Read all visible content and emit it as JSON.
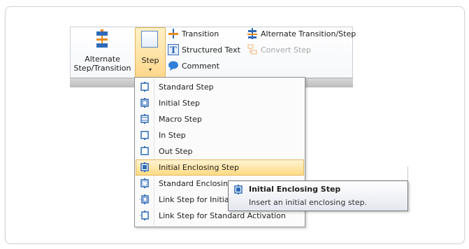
{
  "ribbon": {
    "alt_button": {
      "label_line1": "Alternate",
      "label_line2": "Step/Transition",
      "icon": "alternate-step-transition-icon"
    },
    "step_button": {
      "label": "Step",
      "arrow": "▾",
      "icon": "step-icon"
    },
    "small_buttons": [
      {
        "label": "Transition",
        "icon": "transition-icon",
        "enabled": true
      },
      {
        "label": "Structured Text",
        "icon": "structured-text-icon",
        "enabled": true
      },
      {
        "label": "Comment",
        "icon": "comment-icon",
        "enabled": true
      },
      {
        "label": "Alternate Transition/Step",
        "icon": "alternate-transition-icon",
        "enabled": true
      },
      {
        "label": "Convert Step",
        "icon": "convert-step-icon",
        "enabled": false
      }
    ]
  },
  "menu": {
    "items": [
      {
        "label": "Standard Step",
        "icon": "standard-step-icon"
      },
      {
        "label": "Initial Step",
        "icon": "initial-step-icon"
      },
      {
        "label": "Macro Step",
        "icon": "macro-step-icon"
      },
      {
        "label": "In Step",
        "icon": "in-step-icon"
      },
      {
        "label": "Out Step",
        "icon": "out-step-icon"
      },
      {
        "label": "Initial Enclosing Step",
        "icon": "initial-enclosing-step-icon",
        "highlighted": true
      },
      {
        "label": "Standard Enclosin",
        "icon": "standard-enclosing-step-icon"
      },
      {
        "label": "Link Step for Initia",
        "icon": "link-step-initial-icon"
      },
      {
        "label": "Link Step for Standard Activation",
        "icon": "link-step-standard-icon"
      }
    ]
  },
  "tooltip": {
    "title": "Initial Enclosing Step",
    "description": "Insert an initial enclosing step.",
    "icon": "initial-enclosing-step-icon"
  },
  "colors": {
    "highlight_top": "#fff4d3",
    "highlight_bottom": "#ffdb84",
    "icon_blue": "#2f6ab8",
    "icon_orange": "#e98a1b"
  }
}
